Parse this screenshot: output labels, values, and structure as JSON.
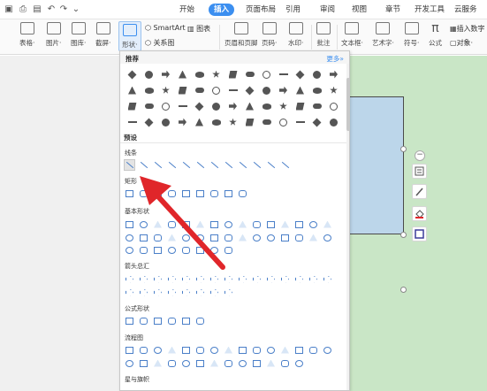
{
  "menu_tabs": [
    "开始",
    "插入",
    "页面布局",
    "引用",
    "审阅",
    "视图",
    "章节",
    "开发工具",
    "云服务"
  ],
  "active_tab": "插入",
  "ribbon": {
    "table": "表格·",
    "picture": "图片·",
    "gallery": "图库·",
    "screenshot": "截屏·",
    "shapes": "形状·",
    "smartart": "SmartArt",
    "chart": "图表",
    "relation": "关系图",
    "header_footer": "页眉和页脚",
    "page_number": "页码·",
    "watermark": "水印·",
    "comment": "批注",
    "textbox": "文本框·",
    "wordart": "艺术字·",
    "symbol": "符号·",
    "formula": "公式",
    "insert_number": "插入数字",
    "object": "对象·"
  },
  "dropdown": {
    "recommended_title": "推荐",
    "more_link": "更多»",
    "preset_title": "预设",
    "categories": {
      "lines": "线条",
      "rectangles": "矩形",
      "basic": "基本形状",
      "arrows": "箭头总汇",
      "formula": "公式形状",
      "flowchart": "流程图",
      "stars": "星与旗帜"
    }
  },
  "colors": {
    "accent": "#3c8ff0",
    "doc_green": "#c9e6c6",
    "shape_fill": "#bcd6ea",
    "arrow_red": "#e0262a"
  },
  "icons": [
    "undo-icon",
    "redo-icon",
    "print-icon",
    "shapes-icon",
    "pen-icon",
    "fill-icon",
    "layout-icon",
    "minus-icon"
  ]
}
